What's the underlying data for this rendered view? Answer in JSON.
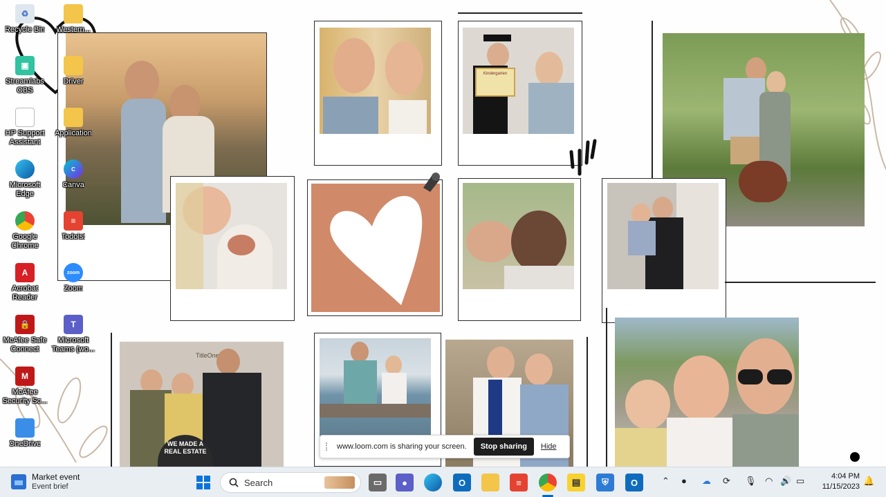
{
  "desktop": {
    "icons": [
      {
        "label": "Recycle Bin"
      },
      {
        "label": "Western..."
      },
      {
        "label": "Streamlabs OBS"
      },
      {
        "label": "Driver"
      },
      {
        "label": "HP Support Assistant"
      },
      {
        "label": "Application"
      },
      {
        "label": "Microsoft Edge"
      },
      {
        "label": "Canva"
      },
      {
        "label": "Google Chrome"
      },
      {
        "label": "Todoist"
      },
      {
        "label": "Acrobat Reader"
      },
      {
        "label": "Zoom"
      },
      {
        "label": "McAfee Safe Connect"
      },
      {
        "label": "Microsoft Teams (wo..."
      },
      {
        "label": "McAfee Security Sc..."
      },
      {
        "label": "OneDrive"
      }
    ]
  },
  "wallpaper": {
    "sign_text": "WE MADE A REAL ESTATE",
    "diploma_text": "Kindergarten",
    "office_text": "TitleOne"
  },
  "loom": {
    "message": "www.loom.com is sharing your screen.",
    "stop_label": "Stop sharing",
    "hide_label": "Hide"
  },
  "taskbar": {
    "widget_title": "Market event",
    "widget_subtitle": "Event brief",
    "search_placeholder": "Search",
    "time": "4:04 PM",
    "date": "11/15/2023",
    "colors": {
      "accent": "#0067c0",
      "bg": "#e9eef3"
    }
  }
}
